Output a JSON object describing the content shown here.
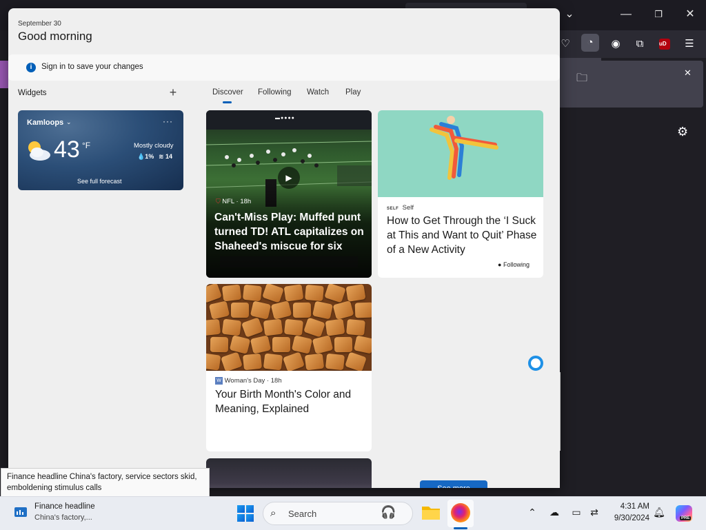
{
  "widgets": {
    "date": "September 30",
    "greeting": "Good morning",
    "signin_message": "Sign in to save your changes",
    "widgets_label": "Widgets",
    "add_label": "+",
    "tabs": [
      {
        "label": "Discover",
        "selected": true
      },
      {
        "label": "Following"
      },
      {
        "label": "Watch"
      },
      {
        "label": "Play"
      }
    ],
    "weather": {
      "location": "Kamloops",
      "temperature": "43",
      "unit": "°F",
      "condition": "Mostly cloudy",
      "precipitation": "1%",
      "wind": "14",
      "forecast_link": "See full forecast",
      "more": "···"
    },
    "cards": [
      {
        "source": "NFL",
        "age": "18h",
        "title": "Can't-Miss Play: Muffed punt turned TD! ATL capitalizes on Shaheed's miscue for six"
      },
      {
        "source": "Self",
        "title": "How to Get Through the ‘I Suck at This and Want to Quit’ Phase of a New Activity",
        "following": "Following"
      },
      {
        "source": "Woman's Day",
        "age": "18h",
        "title": "Your Birth Month's Color and Meaning, Explained"
      }
    ],
    "see_more": "See more"
  },
  "tooltip": {
    "text": "Finance headline China's factory, service sectors skid, emboldening stimulus calls"
  },
  "taskbar": {
    "widget_title": "Finance headline",
    "widget_subtitle": "China's factory,...",
    "search_placeholder": "Search",
    "clock_time": "4:31 AM",
    "clock_date": "9/30/2024",
    "copilot_badge": "PRE"
  },
  "browser": {
    "ublock_label": "uD",
    "icons": [
      "chevron-down-icon",
      "minimize-icon",
      "restore-icon",
      "close-icon",
      "pocket-icon",
      "extension-active-icon",
      "account-icon",
      "extensions-icon",
      "ublock-icon",
      "menu-icon",
      "folder-icon",
      "close-icon",
      "settings-icon"
    ]
  },
  "colors": {
    "accent": "#005fb8",
    "weather_bg": "#2b4e77",
    "see_more_bg": "#1668c4",
    "self_bg": "#8fd7c3"
  }
}
